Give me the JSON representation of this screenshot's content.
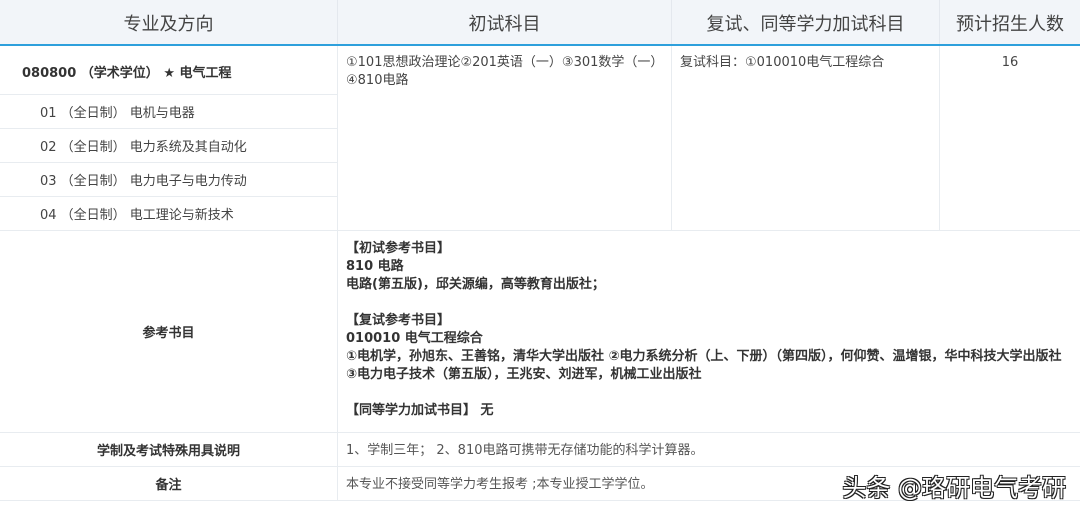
{
  "headers": [
    "专业及方向",
    "初试科目",
    "复试、同等学力加试科目",
    "预计招生人数"
  ],
  "major": {
    "title": "080800 （学术学位） ★ 电气工程",
    "exam": "①101思想政治理论②201英语（一）③301数学（一）④810电路",
    "retest": "复试科目：①010010电气工程综合",
    "quota": "16",
    "directions": [
      "01 （全日制） 电机与电器",
      "02 （全日制） 电力系统及其自动化",
      "03 （全日制） 电力电子与电力传动",
      "04 （全日制） 电工理论与新技术"
    ]
  },
  "refs": {
    "label": "参考书目",
    "lines": [
      "【初试参考书目】",
      "810 电路",
      "电路(第五版)，邱关源编，高等教育出版社；",
      "",
      "【复试参考书目】",
      "010010 电气工程综合",
      "①电机学，孙旭东、王善铭，清华大学出版社 ②电力系统分析（上、下册）（第四版），何仰赞、温增银，华中科技大学出版社 ③电力电子技术（第五版），王兆安、刘进军，机械工业出版社",
      "",
      "【同等学力加试书目】 无"
    ]
  },
  "system": {
    "label": "学制及考试特殊用具说明",
    "text": "1、学制三年； 2、810电路可携带无存储功能的科学计算器。"
  },
  "notes": {
    "label": "备注",
    "text": "本专业不接受同等学力考生报考 ;本专业授工学学位。"
  },
  "watermark": "头条 @珞研电气考研"
}
